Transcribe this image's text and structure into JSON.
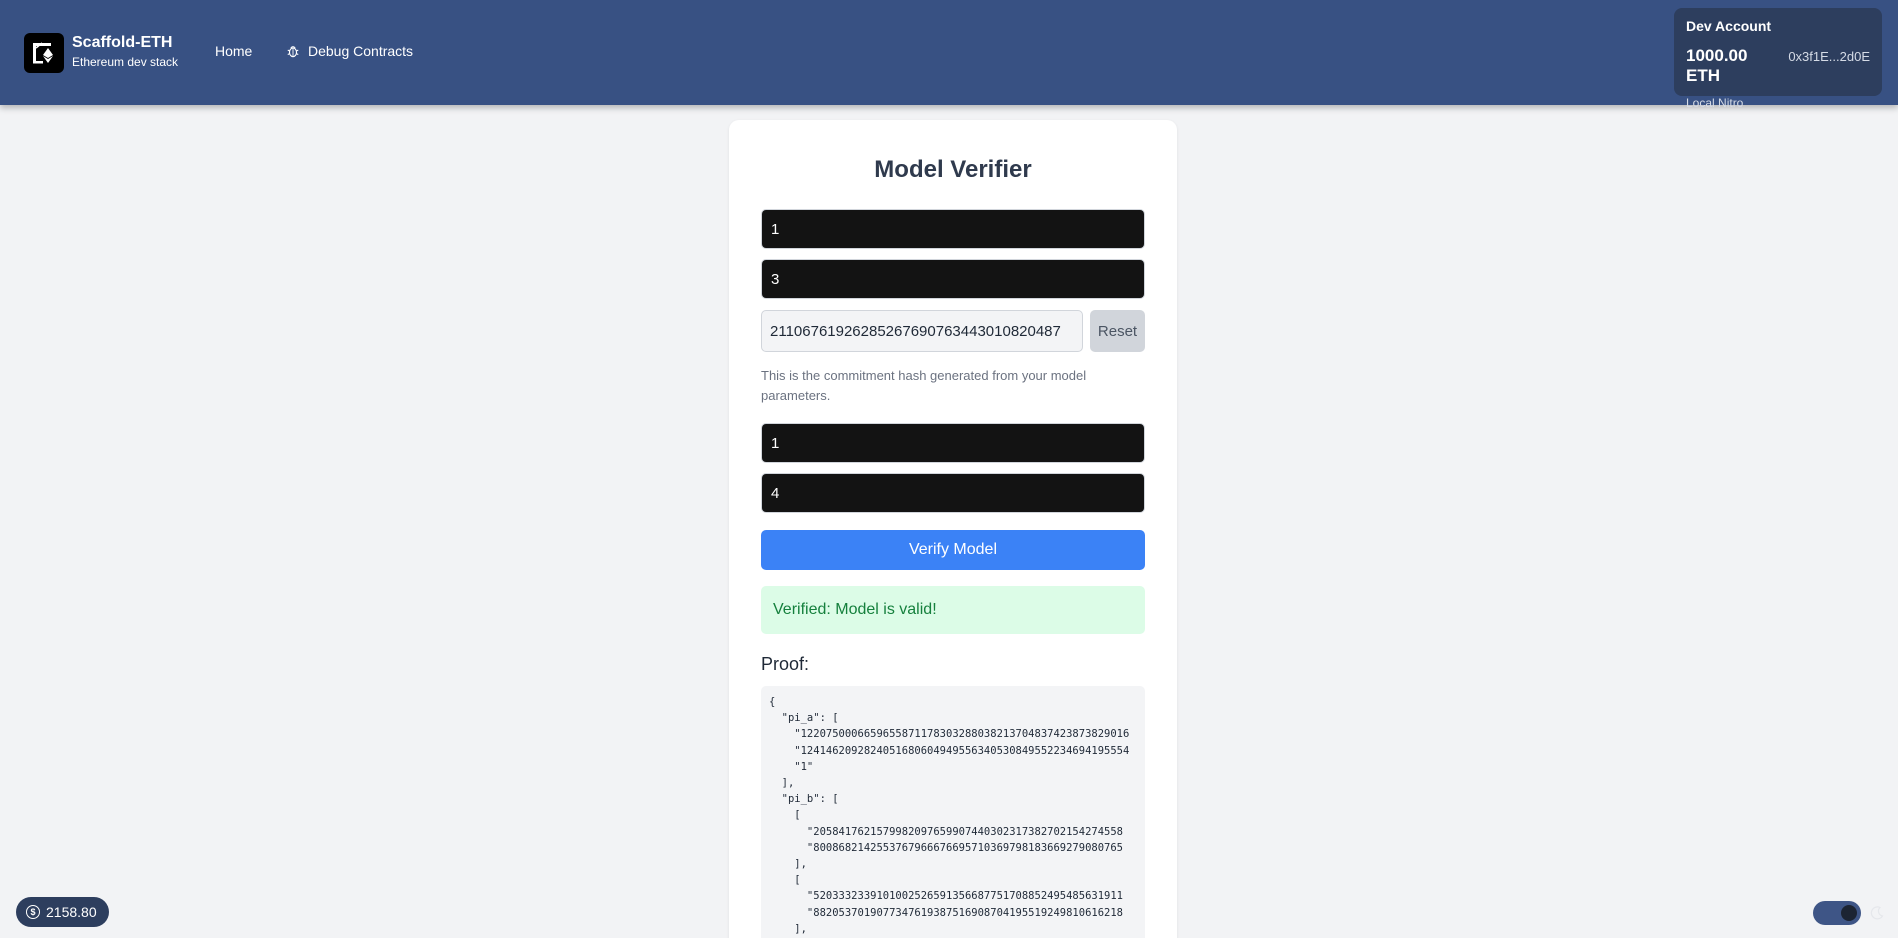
{
  "header": {
    "brand_title": "Scaffold-ETH",
    "brand_subtitle": "Ethereum dev stack",
    "nav": {
      "home": "Home",
      "debug": "Debug Contracts"
    },
    "account": {
      "title": "Dev Account",
      "balance": "1000.00 ETH",
      "address": "0x3f1E...2d0E",
      "network": "Local Nitro"
    }
  },
  "verifier": {
    "title": "Model Verifier",
    "input1_value": "1",
    "input2_value": "3",
    "hash_value": "21106761926285267690763443010820487",
    "reset_label": "Reset",
    "hint": "This is the commitment hash generated from your model parameters.",
    "input3_value": "1",
    "input4_value": "4",
    "verify_label": "Verify Model",
    "success_message": "Verified: Model is valid!",
    "proof_label": "Proof:",
    "proof_text": "{\n  \"pi_a\": [\n    \"1220750006659655871178303288038213704837423873829016\n    \"1241462092824051680604949556340530849552234694195554\n    \"1\"\n  ],\n  \"pi_b\": [\n    [\n      \"2058417621579982097659907440302317382702154274558\n      \"8008682142553767966676695710369798183669279080765\n    ],\n    [\n      \"5203332339101002526591356687751708852495485631911\n      \"8820537019077347619387516908704195519249810616218\n    ],"
  },
  "footer": {
    "price": "2158.80",
    "price_symbol": "$"
  },
  "colors": {
    "header_bg": "#385183",
    "primary_button": "#3b82f6",
    "success_bg": "#dcfce7",
    "success_text": "#15803d"
  }
}
